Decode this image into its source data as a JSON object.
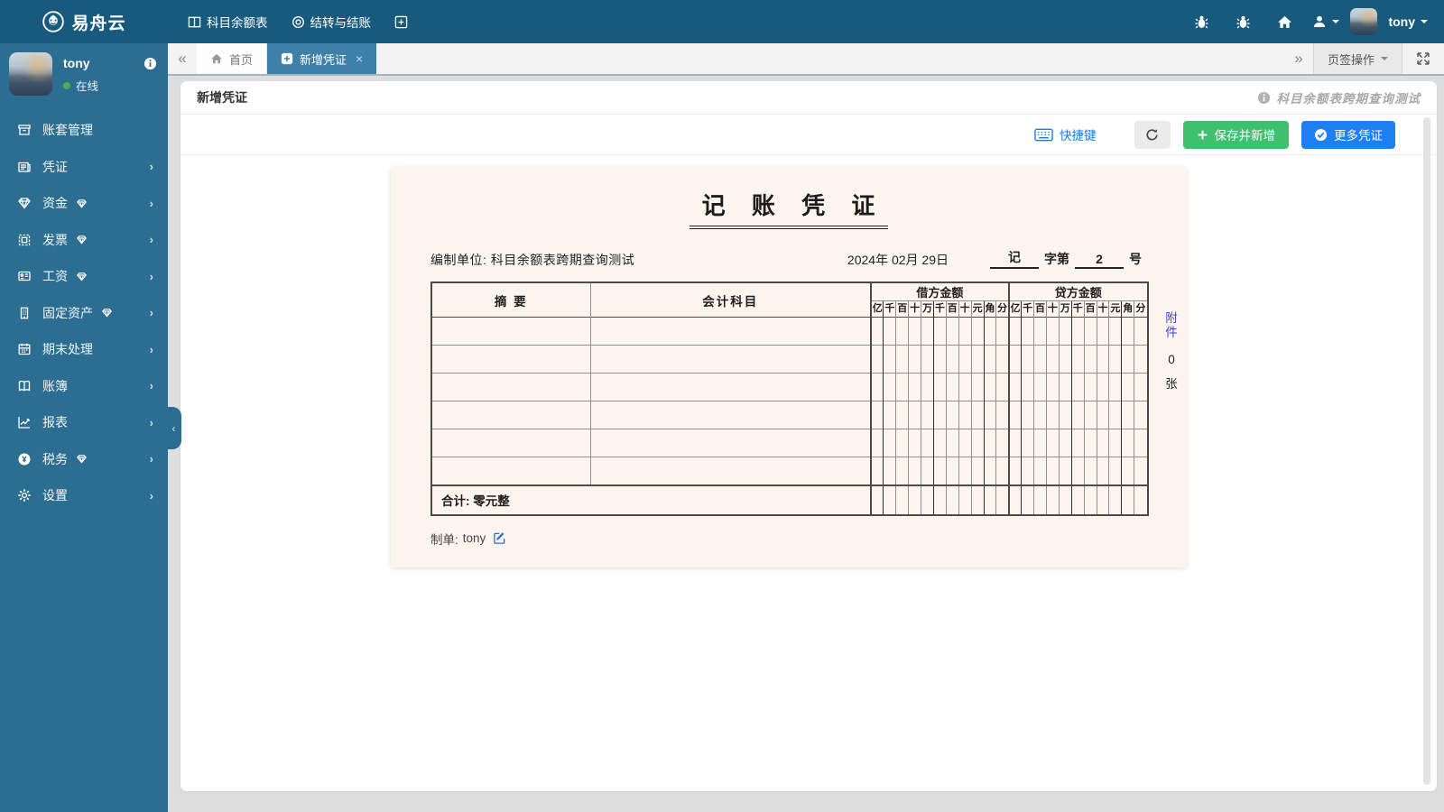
{
  "colors": {
    "topbar_bg": "#175a7d",
    "sidebar_bg": "#2c6e91",
    "active_tab": "#3d80a8",
    "link_blue": "#1a7af0",
    "button_green": "#3ec06e",
    "button_blue": "#1e80f0",
    "paper_bg": "#fcf5ee",
    "attachment_link": "#4040dd",
    "online_green": "#4caf50"
  },
  "topbar": {
    "brand": "易舟云",
    "nav": [
      {
        "label": "科目余额表",
        "icon": "columns-icon"
      },
      {
        "label": "结转与结账",
        "icon": "target-icon"
      },
      {
        "label": "",
        "icon": "plus-square-icon"
      }
    ],
    "user_name": "tony"
  },
  "sidebar": {
    "user": {
      "name": "tony",
      "status": "在线"
    },
    "items": [
      {
        "label": "账套管理"
      },
      {
        "label": "凭证"
      },
      {
        "label": "资金"
      },
      {
        "label": "发票"
      },
      {
        "label": "工资"
      },
      {
        "label": "固定资产"
      },
      {
        "label": "期末处理"
      },
      {
        "label": "账簿"
      },
      {
        "label": "报表"
      },
      {
        "label": "税务"
      },
      {
        "label": "设置"
      }
    ]
  },
  "tabbar": {
    "tabs": [
      {
        "label": "首页"
      },
      {
        "label": "新增凭证"
      }
    ],
    "tab_ops_label": "页签操作"
  },
  "panel": {
    "title": "新增凭证",
    "watermark": "科目余额表跨期查询测试"
  },
  "toolbar": {
    "shortcut_label": "快捷键",
    "save_new_label": "保存并新增",
    "more_label": "更多凭证"
  },
  "voucher": {
    "title": "记 账 凭 证",
    "unit_label": "编制单位:",
    "unit_value": "科目余额表跨期查询测试",
    "date": "2024年 02月 29日",
    "word_prefix": "记",
    "word_middle": "字第",
    "number": "2",
    "word_suffix": "号",
    "table": {
      "col_summary": "摘 要",
      "col_account": "会计科目",
      "col_debit": "借方金额",
      "col_credit": "贷方金额",
      "digit_units": [
        "亿",
        "千",
        "百",
        "十",
        "万",
        "千",
        "百",
        "十",
        "元",
        "角",
        "分"
      ],
      "body_rows": 6,
      "total_label": "合计: 零元整"
    },
    "attachment": {
      "link": "附件",
      "count": "0",
      "unit": "张"
    },
    "maker_label": "制单:",
    "maker_value": "tony"
  }
}
